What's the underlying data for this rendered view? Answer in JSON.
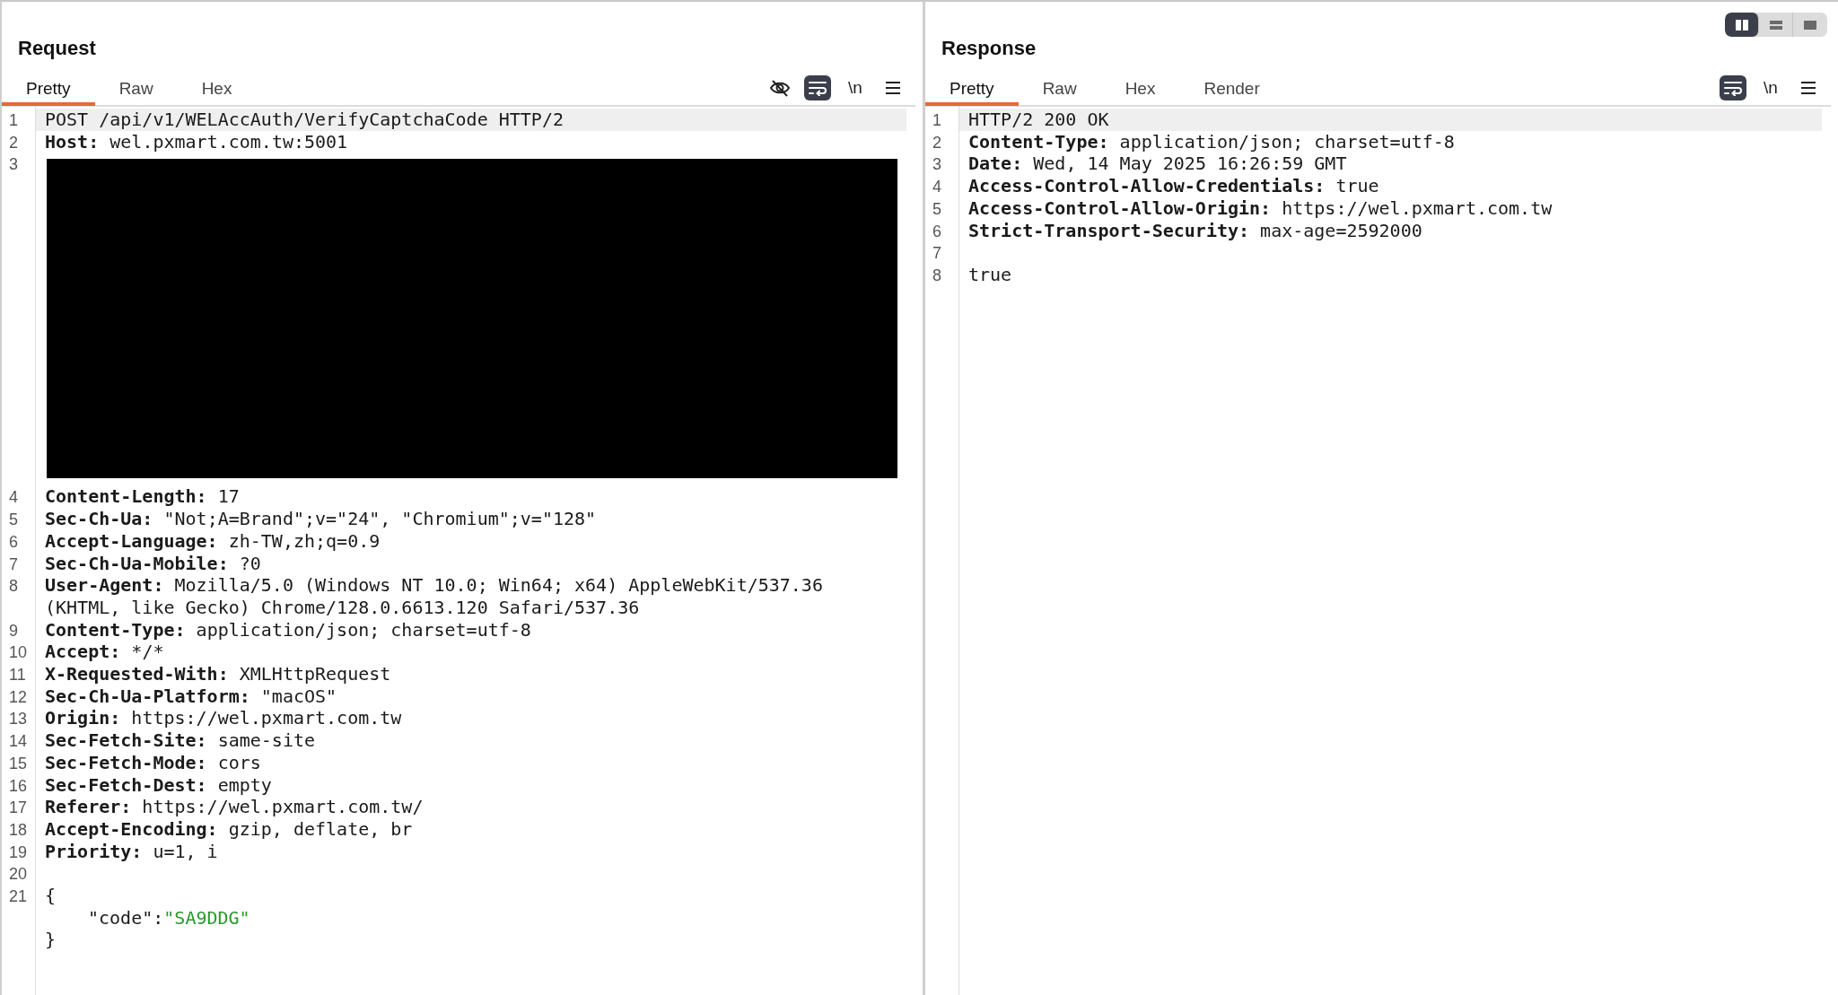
{
  "layout_switch": [
    {
      "kind": "columns",
      "selected": true
    },
    {
      "kind": "rows",
      "selected": false
    },
    {
      "kind": "single",
      "selected": false
    }
  ],
  "request": {
    "title": "Request",
    "tabs": [
      {
        "label": "Pretty",
        "selected": true
      },
      {
        "label": "Raw",
        "selected": false
      },
      {
        "label": "Hex",
        "selected": false
      }
    ],
    "toolbar": [
      {
        "kind": "hide",
        "on": false
      },
      {
        "kind": "wrap",
        "on": true
      },
      {
        "kind": "newline",
        "label": "\\n",
        "on": false
      },
      {
        "kind": "menu",
        "on": false
      }
    ],
    "lines": [
      {
        "number": "1",
        "kind": "text",
        "text": "POST /api/v1/WELAccAuth/VerifyCaptchaCode HTTP/2",
        "highlighted": true
      },
      {
        "number": "2",
        "kind": "header",
        "name": "Host:",
        "value": "wel.pxmart.com.tw:5001",
        "highlighted": false
      },
      {
        "number": "3",
        "kind": "redacted"
      },
      {
        "number": "4",
        "kind": "header",
        "name": "Content-Length:",
        "value": "17",
        "highlighted": false
      },
      {
        "number": "5",
        "kind": "header",
        "name": "Sec-Ch-Ua:",
        "value": "\"Not;A=Brand\";v=\"24\", \"Chromium\";v=\"128\"",
        "highlighted": false
      },
      {
        "number": "6",
        "kind": "header",
        "name": "Accept-Language:",
        "value": "zh-TW,zh;q=0.9",
        "highlighted": false
      },
      {
        "number": "7",
        "kind": "header",
        "name": "Sec-Ch-Ua-Mobile:",
        "value": "?0",
        "highlighted": false
      },
      {
        "number": "8",
        "kind": "header",
        "name": "User-Agent:",
        "value": "Mozilla/5.0 (Windows NT 10.0; Win64; x64) AppleWebKit/537.36",
        "continuation": "(KHTML, like Gecko) Chrome/128.0.6613.120 Safari/537.36",
        "highlighted": false
      },
      {
        "number": "9",
        "kind": "header",
        "name": "Content-Type:",
        "value": "application/json; charset=utf-8",
        "highlighted": false
      },
      {
        "number": "10",
        "kind": "header",
        "name": "Accept:",
        "value": "*/*",
        "highlighted": false
      },
      {
        "number": "11",
        "kind": "header",
        "name": "X-Requested-With:",
        "value": "XMLHttpRequest",
        "highlighted": false
      },
      {
        "number": "12",
        "kind": "header",
        "name": "Sec-Ch-Ua-Platform:",
        "value": "\"macOS\"",
        "highlighted": false
      },
      {
        "number": "13",
        "kind": "header",
        "name": "Origin:",
        "value": "https://wel.pxmart.com.tw",
        "highlighted": false
      },
      {
        "number": "14",
        "kind": "header",
        "name": "Sec-Fetch-Site:",
        "value": "same-site",
        "highlighted": false
      },
      {
        "number": "15",
        "kind": "header",
        "name": "Sec-Fetch-Mode:",
        "value": "cors",
        "highlighted": false
      },
      {
        "number": "16",
        "kind": "header",
        "name": "Sec-Fetch-Dest:",
        "value": "empty",
        "highlighted": false
      },
      {
        "number": "17",
        "kind": "header",
        "name": "Referer:",
        "value": "https://wel.pxmart.com.tw/",
        "highlighted": false
      },
      {
        "number": "18",
        "kind": "header",
        "name": "Accept-Encoding:",
        "value": "gzip, deflate, br",
        "highlighted": false
      },
      {
        "number": "19",
        "kind": "header",
        "name": "Priority:",
        "value": "u=1, i",
        "highlighted": false
      },
      {
        "number": "20",
        "kind": "blank",
        "highlighted": false
      },
      {
        "number": "21",
        "kind": "text",
        "text": "{",
        "highlighted": false
      },
      {
        "kind": "json_pair",
        "key": "\"code\":",
        "value": "\"SA9DDG\"",
        "highlighted": false
      },
      {
        "kind": "text",
        "text": "}",
        "highlighted": false
      }
    ]
  },
  "response": {
    "title": "Response",
    "tabs": [
      {
        "label": "Pretty",
        "selected": true
      },
      {
        "label": "Raw",
        "selected": false
      },
      {
        "label": "Hex",
        "selected": false
      },
      {
        "label": "Render",
        "selected": false
      }
    ],
    "toolbar": [
      {
        "kind": "wrap",
        "on": true
      },
      {
        "kind": "newline",
        "label": "\\n",
        "on": false
      },
      {
        "kind": "menu",
        "on": false
      }
    ],
    "lines": [
      {
        "number": "1",
        "kind": "text",
        "text": "HTTP/2 200 OK",
        "highlighted": true
      },
      {
        "number": "2",
        "kind": "header",
        "name": "Content-Type:",
        "value": "application/json; charset=utf-8",
        "highlighted": false
      },
      {
        "number": "3",
        "kind": "header",
        "name": "Date:",
        "value": "Wed, 14 May 2025 16:26:59 GMT",
        "highlighted": false
      },
      {
        "number": "4",
        "kind": "header",
        "name": "Access-Control-Allow-Credentials:",
        "value": "true",
        "highlighted": false
      },
      {
        "number": "5",
        "kind": "header",
        "name": "Access-Control-Allow-Origin:",
        "value": "https://wel.pxmart.com.tw",
        "highlighted": false
      },
      {
        "number": "6",
        "kind": "header",
        "name": "Strict-Transport-Security:",
        "value": "max-age=2592000",
        "highlighted": false
      },
      {
        "number": "7",
        "kind": "blank",
        "highlighted": false
      },
      {
        "number": "8",
        "kind": "text",
        "text": "true",
        "highlighted": false
      }
    ]
  }
}
